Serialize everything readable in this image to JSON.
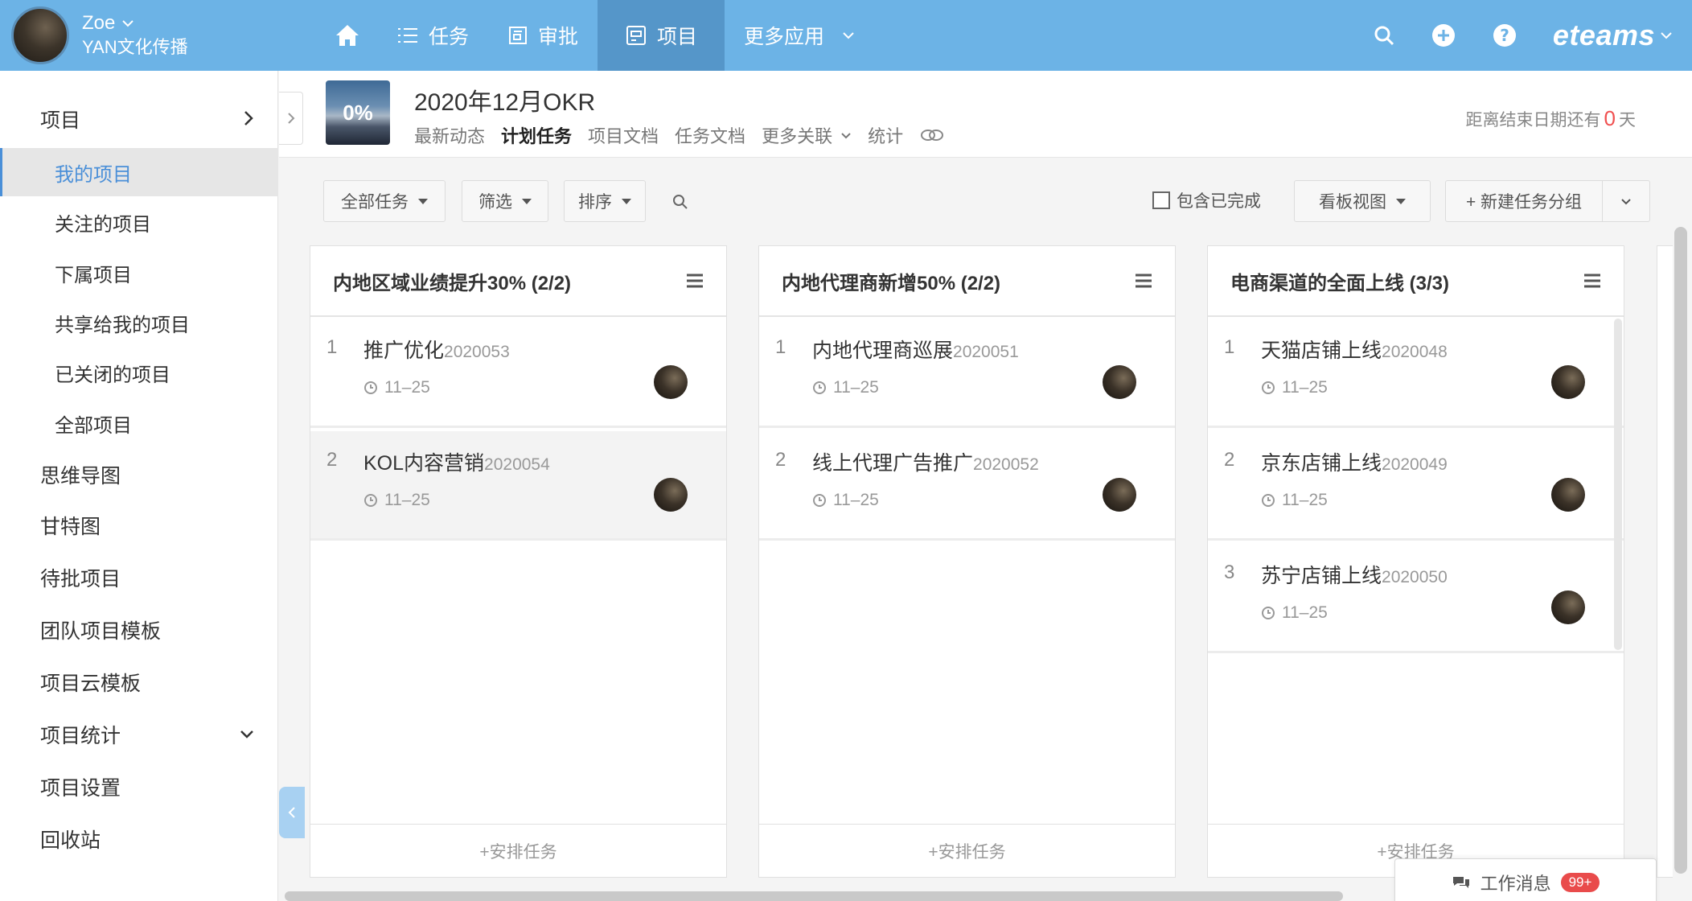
{
  "user": {
    "name": "Zoe",
    "org": "YAN文化传播"
  },
  "nav": [
    {
      "label": "任务"
    },
    {
      "label": "审批"
    },
    {
      "label": "项目"
    },
    {
      "label": "更多应用"
    }
  ],
  "brand": "eteams",
  "sidebar": {
    "items": [
      {
        "label": "项目"
      },
      {
        "label": "我的项目"
      },
      {
        "label": "关注的项目"
      },
      {
        "label": "下属项目"
      },
      {
        "label": "共享给我的项目"
      },
      {
        "label": "已关闭的项目"
      },
      {
        "label": "全部项目"
      },
      {
        "label": "思维导图"
      },
      {
        "label": "甘特图"
      },
      {
        "label": "待批项目"
      },
      {
        "label": "团队项目模板"
      },
      {
        "label": "项目云模板"
      },
      {
        "label": "项目统计"
      },
      {
        "label": "项目设置"
      },
      {
        "label": "回收站"
      }
    ]
  },
  "project": {
    "progress": "0%",
    "title": "2020年12月OKR",
    "tabs": [
      "最新动态",
      "计划任务",
      "项目文档",
      "任务文档",
      "更多关联",
      "统计"
    ],
    "deadline_prefix": "距离结束日期还有",
    "deadline_days": "0",
    "deadline_suffix": "天"
  },
  "toolbar": {
    "all_tasks": "全部任务",
    "filter": "筛选",
    "sort": "排序",
    "include_done": "包含已完成",
    "view": "看板视图",
    "new_group": "+ 新建任务分组"
  },
  "columns": [
    {
      "title": "内地区域业绩提升30% (2/2)",
      "cards": [
        {
          "num": "1",
          "title": "推广优化",
          "code": "2020053",
          "date": "11–25"
        },
        {
          "num": "2",
          "title": "KOL内容营销",
          "code": "2020054",
          "date": "11–25"
        }
      ],
      "footer": "+安排任务"
    },
    {
      "title": "内地代理商新增50% (2/2)",
      "cards": [
        {
          "num": "1",
          "title": "内地代理商巡展",
          "code": "2020051",
          "date": "11–25"
        },
        {
          "num": "2",
          "title": "线上代理广告推广",
          "code": "2020052",
          "date": "11–25"
        }
      ],
      "footer": "+安排任务"
    },
    {
      "title": "电商渠道的全面上线 (3/3)",
      "cards": [
        {
          "num": "1",
          "title": "天猫店铺上线",
          "code": "2020048",
          "date": "11–25"
        },
        {
          "num": "2",
          "title": "京东店铺上线",
          "code": "2020049",
          "date": "11–25"
        },
        {
          "num": "3",
          "title": "苏宁店铺上线",
          "code": "2020050",
          "date": "11–25"
        }
      ],
      "footer": "+安排任务"
    }
  ],
  "messages": {
    "label": "工作消息",
    "count": "99+"
  }
}
